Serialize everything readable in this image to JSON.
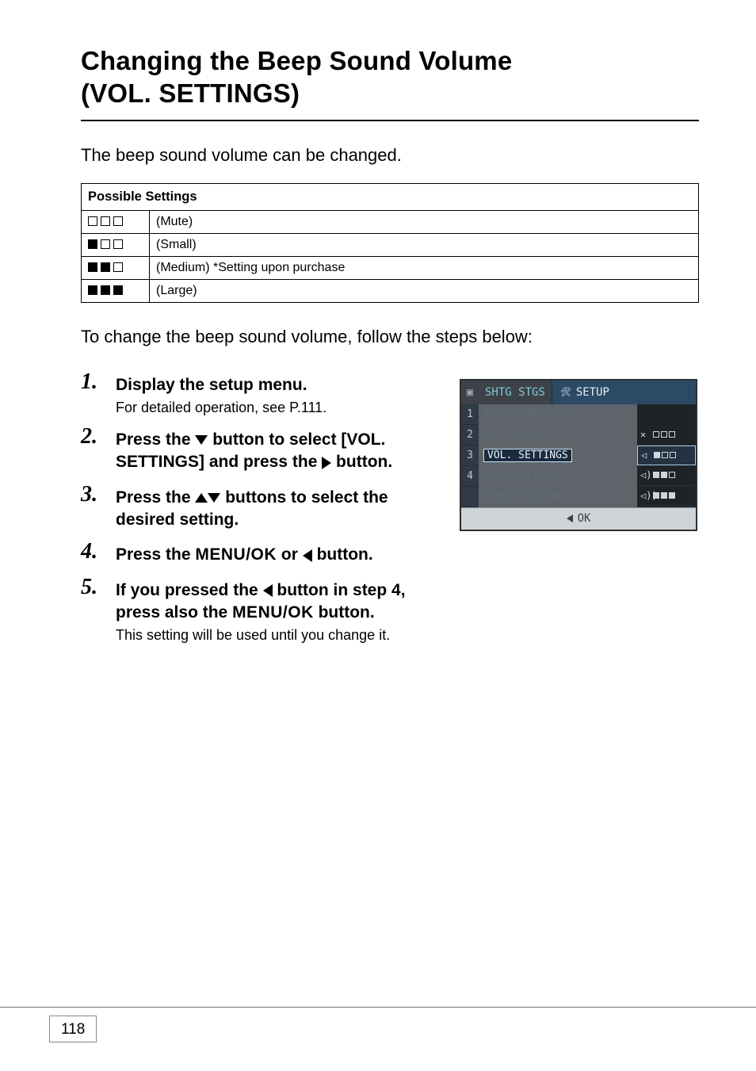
{
  "title_line1": "Changing the Beep Sound Volume",
  "title_line2": "(VOL. SETTINGS)",
  "intro": "The beep sound volume can be changed.",
  "table": {
    "header": "Possible Settings",
    "rows": [
      {
        "filled": 0,
        "label": "(Mute)"
      },
      {
        "filled": 1,
        "label": "(Small)"
      },
      {
        "filled": 2,
        "label": "(Medium) *Setting upon purchase"
      },
      {
        "filled": 3,
        "label": "(Large)"
      }
    ]
  },
  "steps_intro": "To change the beep sound volume, follow the steps below:",
  "steps": {
    "s1_head": "Display the setup menu.",
    "s1_sub": "For detailed operation, see P.111.",
    "s2_a": "Press the ",
    "s2_b": " button to select [VOL. SETTINGS] and press the ",
    "s2_c": " button.",
    "s3_a": "Press the ",
    "s3_b": " buttons to select the desired setting.",
    "s4_a": "Press the ",
    "s4_menu": "MENU/OK",
    "s4_b": " or ",
    "s4_c": " button.",
    "s5_a": "If you pressed the ",
    "s5_b": " button in step 4, press also the ",
    "s5_menu": "MENU/OK",
    "s5_c": " button.",
    "s5_sub": "This setting will be used until you change it."
  },
  "lcd": {
    "tab1": "SHTG STGS",
    "tab2": "SETUP",
    "nums": [
      "1",
      "2",
      "3",
      "4"
    ],
    "items": [
      {
        "label": "AUTO POWER OFF",
        "dim": true
      },
      {
        "label": "BEEP SOUND",
        "dim": true
      },
      {
        "label": "VOL. SETTINGS",
        "selected": true
      },
      {
        "label": "LCD CONFIRM.",
        "dim": true
      },
      {
        "label": "SEQUENTIAL NO.",
        "dim": true
      }
    ],
    "options": [
      {
        "speaker": "✕",
        "filled": 0
      },
      {
        "speaker": "◁",
        "filled": 1,
        "selected": true
      },
      {
        "speaker": "◁)",
        "filled": 2
      },
      {
        "speaker": "◁))",
        "filled": 3
      }
    ],
    "footer": "OK"
  },
  "page_number": "118"
}
